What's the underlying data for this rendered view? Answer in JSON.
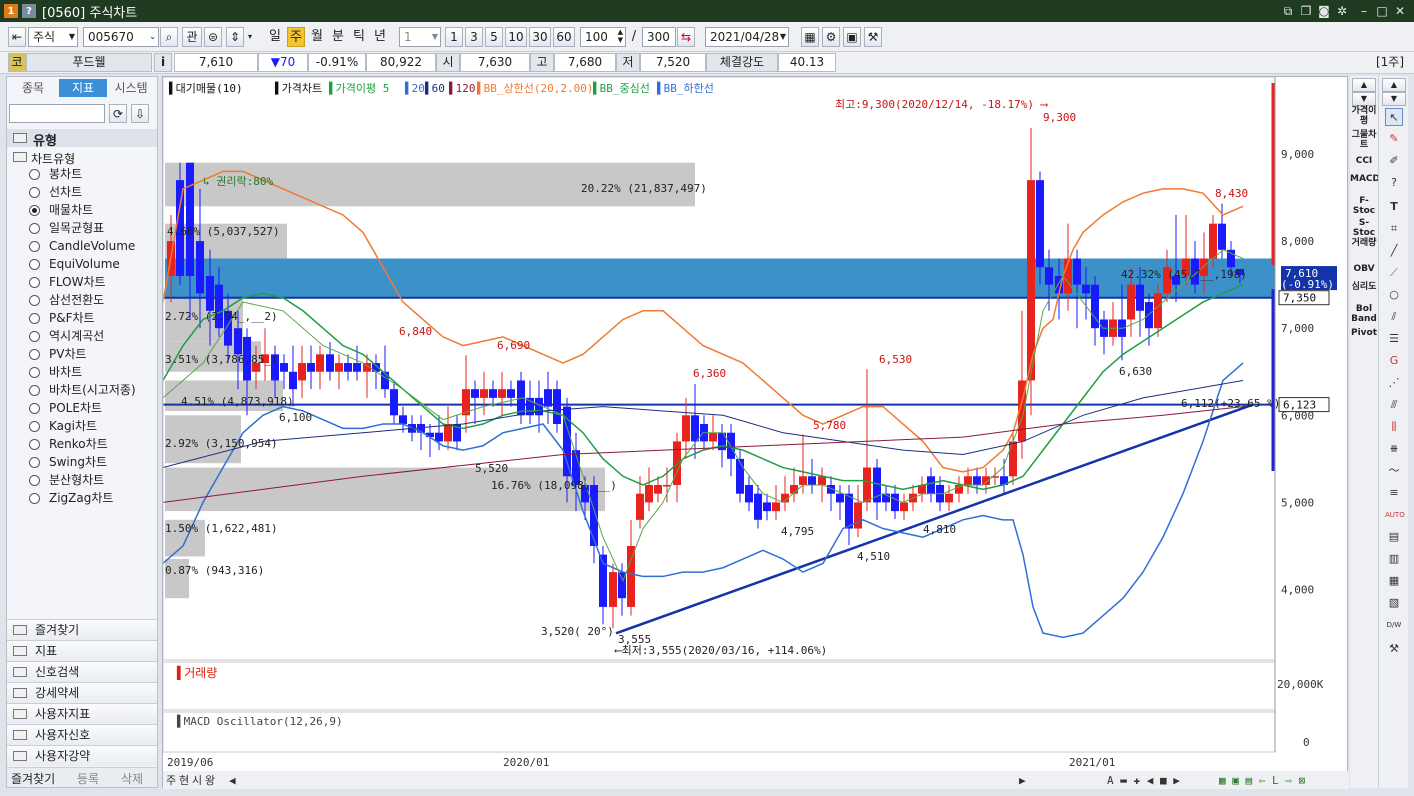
{
  "window": {
    "title": "[0560] 주식차트"
  },
  "toolbar": {
    "market": "주식",
    "code": "005670",
    "btn_gwan": "관",
    "periods": [
      "일",
      "주",
      "월",
      "분",
      "틱",
      "년"
    ],
    "interval": "1",
    "quick_intervals": [
      "1",
      "3",
      "5",
      "10",
      "30",
      "60"
    ],
    "zoom": "100",
    "zoom_sep": "/",
    "total": "300",
    "date": "2021/04/28"
  },
  "quote": {
    "tag": "코",
    "name": "푸드웰",
    "info": "i",
    "price": "7,610",
    "change": "▼70",
    "rate": "-0.91%",
    "volume": "80,922",
    "open_label": "시",
    "open": "7,630",
    "high_label": "고",
    "high": "7,680",
    "low_label": "저",
    "low": "7,520",
    "strength_label": "체결강도",
    "strength": "40.13",
    "unit": "[1주]"
  },
  "left": {
    "tabs": [
      "종목",
      "지표",
      "시스템"
    ],
    "section": "유형",
    "group": "차트유형",
    "types": [
      "봉차트",
      "선차트",
      "매물차트",
      "일목균형표",
      "CandleVolume",
      "EquiVolume",
      "FLOW차트",
      "삼선전환도",
      "P&F차트",
      "역시계곡선",
      "PV차트",
      "바차트",
      "바차트(시고저종)",
      "POLE차트",
      "Kagi차트",
      "Renko차트",
      "Swing차트",
      "분산형차트",
      "ZigZag차트"
    ],
    "selected_index": 2,
    "accordion": [
      "즐겨찾기",
      "지표",
      "신호검색",
      "강세약세",
      "사용자지표",
      "사용자신호",
      "사용자강약"
    ],
    "bottom_tabs": [
      "즐겨찾기",
      "등록",
      "삭제"
    ]
  },
  "chart": {
    "legend": [
      "대기매물(10)",
      "가격차트",
      "가격이평 5",
      "20",
      "60",
      "120",
      "BB_상한선(20,2.00)",
      "BB_중심선",
      "BB_하한선"
    ],
    "price_axis": [
      "9,000",
      "8,000",
      "7,000",
      "6,000",
      "5,000",
      "4,000"
    ],
    "volume_axis": "20,000K",
    "macd_axis": "0",
    "volume_title": "거래량",
    "macd_title": "MACD Oscillator(12,26,9)",
    "x_labels": [
      "2019/06",
      "2020/01",
      "2021/01"
    ],
    "annotations": {
      "high_note": "최고:9,300(2020/12/14, -18.17%)",
      "low_note": "최저:3,555(2020/03/16, +114.06%)",
      "rights": "권리락:80%",
      "trend": "3,520( 20°)",
      "trend_end": "6,112(+23.65 %)",
      "peaks": [
        "9,300",
        "8,430",
        "6,840",
        "6,690",
        "6,360",
        "6,530",
        "5,780",
        "6,630",
        "6,100",
        "5,520",
        "4,795",
        "4,510",
        "4,810",
        "3,555"
      ],
      "price_tag": "7,610",
      "price_tag_sub": "(-0.91%)",
      "line_tag1": "7,350",
      "line_tag2": "6,123"
    },
    "volume_profile": [
      {
        "label": "20.22% (21,837,497)"
      },
      {
        "label": "4.66% (5,037,527)"
      },
      {
        "label": "42.32% (45,7__,198)"
      },
      {
        "label": "2.72% (2,94_,__2)"
      },
      {
        "label": "3.51% (3,786,85_)"
      },
      {
        "label": "4.51% (4,873,918)"
      },
      {
        "label": "2.92% (3,150,954)"
      },
      {
        "label": "16.76% (18,098,___)"
      },
      {
        "label": "1.50% (1,622,481)"
      },
      {
        "label": "0.87% (943,316)"
      }
    ]
  },
  "bottom": {
    "tabs": [
      "주",
      "현",
      "시",
      "왕"
    ]
  },
  "right_indicators": [
    "가격이평",
    "그물차트",
    "CCI",
    "MACD",
    "F-Stoc",
    "S-Stoc",
    "거래량",
    "OBV",
    "심리도",
    "Bol Band",
    "Pivot"
  ],
  "colors": {
    "up": "#e8231e",
    "down": "#1a1aff",
    "bb_upper": "#f07a33",
    "bb_mid": "#1f9e43",
    "bb_lower": "#2f6fd6",
    "trend": "#1433a8",
    "profile": "#c8c8c8",
    "profile_hl": "#3c92c8"
  }
}
